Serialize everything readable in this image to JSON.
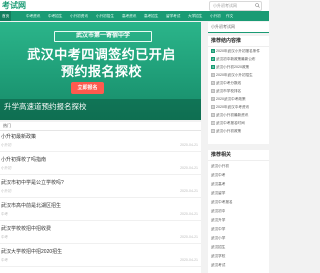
{
  "header": {
    "logo": "考试网",
    "search_placeholder": "小升初考试网"
  },
  "nav": [
    "首页",
    "中考资讯",
    "中考招生",
    "小升初资讯",
    "小升初招生",
    "高考资讯",
    "高考招生",
    "留学考试",
    "大学招生",
    "小升初",
    "作文"
  ],
  "banner": {
    "school": "武汉市第一寄宿中学",
    "line1": "武汉中考四调签约已开启",
    "line2": "预约报名探校",
    "cta": "立即报名",
    "caption": "升学高速道预约报名探校"
  },
  "list": {
    "tab": "热门",
    "items": [
      {
        "title": "小升初最新政策",
        "meta": "小升初",
        "date": "2020-04-21"
      },
      {
        "title": "小升初择校了吗指南",
        "meta": "小升初",
        "date": "2020-04-21"
      },
      {
        "title": "武汉市初中学是公立学校吗?",
        "meta": "小升初",
        "date": "2020-04-21"
      },
      {
        "title": "武汉市高中前是北湖区招生",
        "meta": "中考",
        "date": "2020-04-21"
      },
      {
        "title": "武汉学校校招中招收费",
        "meta": "中考",
        "date": "2020-04-21"
      },
      {
        "title": "武汉大学校招中招2020招生",
        "meta": "中考",
        "date": "2020-04-21"
      }
    ]
  },
  "sidebar": {
    "search_text": "小升初考试网",
    "recommend_title": "推荐结内容推",
    "recommend": [
      "2020年武汉小升初报名条件",
      "武汉初中新政策最新公布",
      "武汉小升初2020政策",
      "2020年武汉小升初招生",
      "武汉中考分数线",
      "武汉市学校排名",
      "2020武汉中考政策",
      "2020年武汉中考资讯",
      "武汉小升初最新资讯",
      "武汉中考报名时间",
      "武汉小升初政策"
    ],
    "tags_title": "推荐相关",
    "tags": [
      "武汉小升初",
      "武汉中考",
      "武汉高考",
      "武汉留学",
      "武汉中考报名",
      "武汉初中",
      "武汉升学",
      "武汉中学",
      "武汉小学",
      "武汉招生",
      "武汉学校",
      "武汉考试"
    ]
  }
}
